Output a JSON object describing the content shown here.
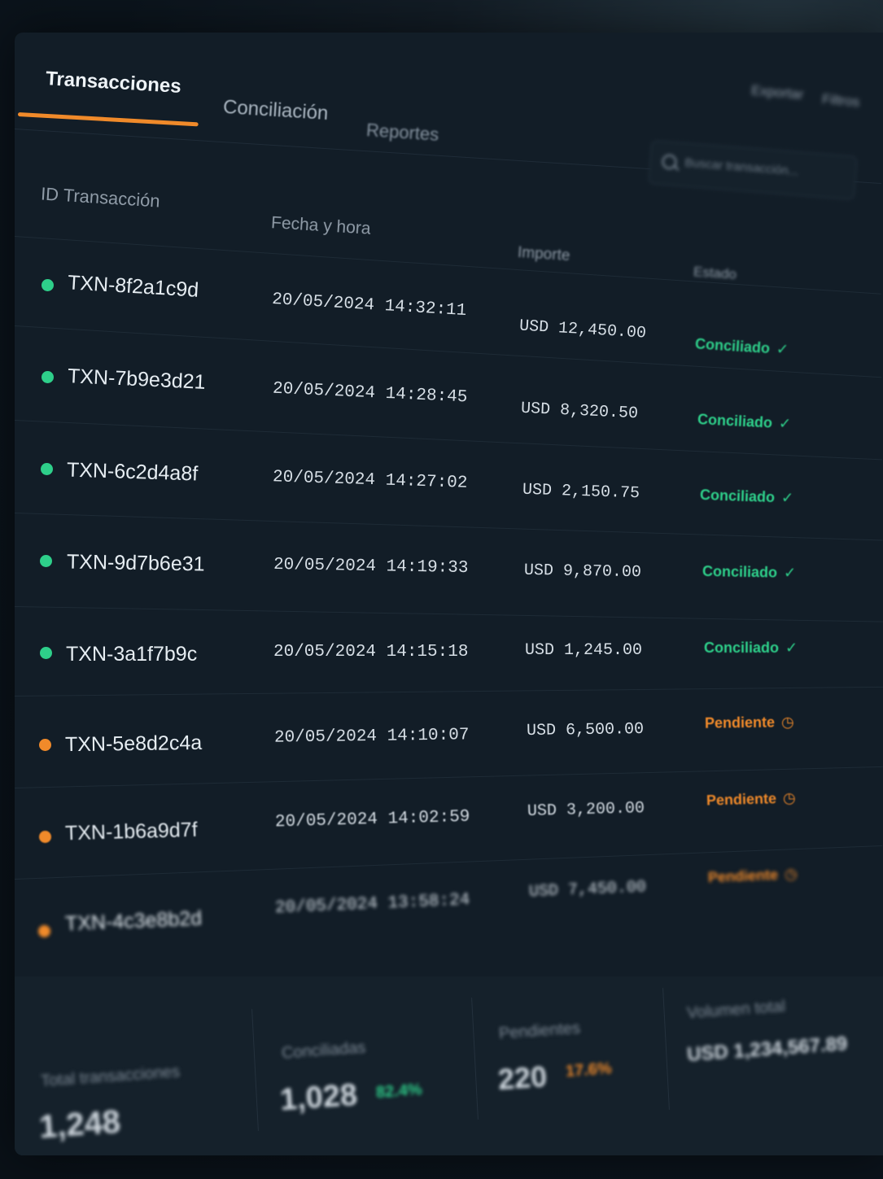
{
  "tabs": [
    {
      "label": "Transacciones",
      "active": true
    },
    {
      "label": "Conciliación",
      "active": false
    },
    {
      "label": "Reportes",
      "active": false
    }
  ],
  "top_actions": [
    "Exportar",
    "Filtros"
  ],
  "search": {
    "placeholder": "Buscar transacción...",
    "icon": "search-icon"
  },
  "table": {
    "headers": [
      "ID Transacción",
      "Fecha y hora",
      "Importe",
      "Estado"
    ],
    "rows": [
      {
        "id": "TXN-8f2a1c9d",
        "datetime": "20/05/2024 14:32:11",
        "amount": "USD 12,450.00",
        "status": "Conciliado",
        "status_icon": "check-icon",
        "dot_color": "#2ecf8a"
      },
      {
        "id": "TXN-7b9e3d21",
        "datetime": "20/05/2024 14:28:45",
        "amount": "USD 8,320.50",
        "status": "Conciliado",
        "status_icon": "check-icon",
        "dot_color": "#2ecf8a"
      },
      {
        "id": "TXN-6c2d4a8f",
        "datetime": "20/05/2024 14:27:02",
        "amount": "USD 2,150.75",
        "status": "Conciliado",
        "status_icon": "check-icon",
        "dot_color": "#2ecf8a"
      },
      {
        "id": "TXN-9d7b6e31",
        "datetime": "20/05/2024 14:19:33",
        "amount": "USD 9,870.00",
        "status": "Conciliado",
        "status_icon": "check-icon",
        "dot_color": "#2ecf8a"
      },
      {
        "id": "TXN-3a1f7b9c",
        "datetime": "20/05/2024 14:15:18",
        "amount": "USD 1,245.00",
        "status": "Conciliado",
        "status_icon": "check-icon",
        "dot_color": "#2ecf8a"
      },
      {
        "id": "TXN-5e8d2c4a",
        "datetime": "20/05/2024 14:10:07",
        "amount": "USD 6,500.00",
        "status": "Pendiente",
        "status_icon": "clock-icon",
        "dot_color": "#f08a2a"
      },
      {
        "id": "TXN-1b6a9d7f",
        "datetime": "20/05/2024 14:02:59",
        "amount": "USD 3,200.00",
        "status": "Pendiente",
        "status_icon": "clock-icon",
        "dot_color": "#f08a2a"
      },
      {
        "id": "TXN-4c3e8b2d",
        "datetime": "20/05/2024 13:58:24",
        "amount": "USD 7,450.00",
        "status": "Pendiente",
        "status_icon": "clock-icon",
        "dot_color": "#f08a2a"
      }
    ]
  },
  "summary": {
    "total": {
      "label": "Total transacciones",
      "value": "1,248"
    },
    "reconciled": {
      "label": "Conciliadas",
      "value": "1,028",
      "pct": "82.4%"
    },
    "pending": {
      "label": "Pendientes",
      "value": "220",
      "pct": "17.6%"
    },
    "volume": {
      "label": "Volumen total",
      "value": "USD 1,234,567.89"
    }
  },
  "colors": {
    "accent": "#f08a2a",
    "success": "#2ecf8a",
    "background": "#121d27"
  }
}
